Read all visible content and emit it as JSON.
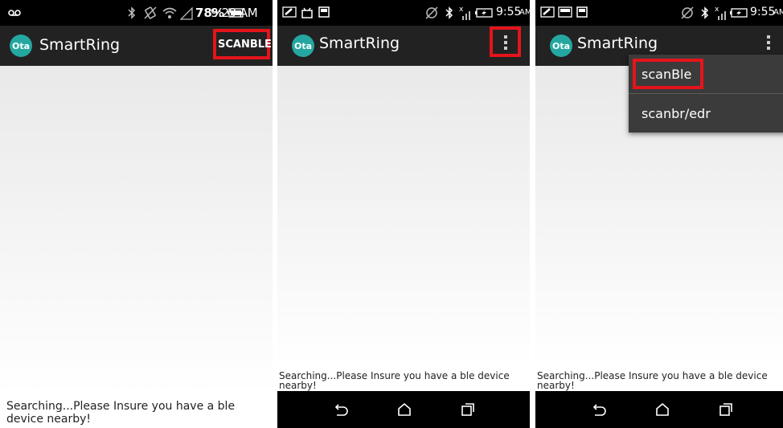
{
  "app": {
    "name": "SmartRing",
    "logo_text": "Ota"
  },
  "panel1": {
    "status": {
      "battery": "78%",
      "time": "9:29 AM"
    },
    "action_button": "SCANBLE",
    "message": "Searching...Please Insure you have a ble device nearby!"
  },
  "panel2": {
    "status": {
      "time": "9:55",
      "ampm": "AM"
    },
    "overflow_icon": "overflow-menu-icon",
    "message": "Searching...Please Insure you have a ble device nearby!"
  },
  "panel3": {
    "status": {
      "time": "9:55",
      "ampm": "AM"
    },
    "menu": [
      "scanBle",
      "scanbr/edr"
    ],
    "message": "Searching...Please Insure you have a ble device nearby!"
  },
  "colors": {
    "highlight": "#e4141b",
    "logo": "#25a7a1",
    "actionbar": "#222222",
    "menu": "#3b3b3b"
  }
}
